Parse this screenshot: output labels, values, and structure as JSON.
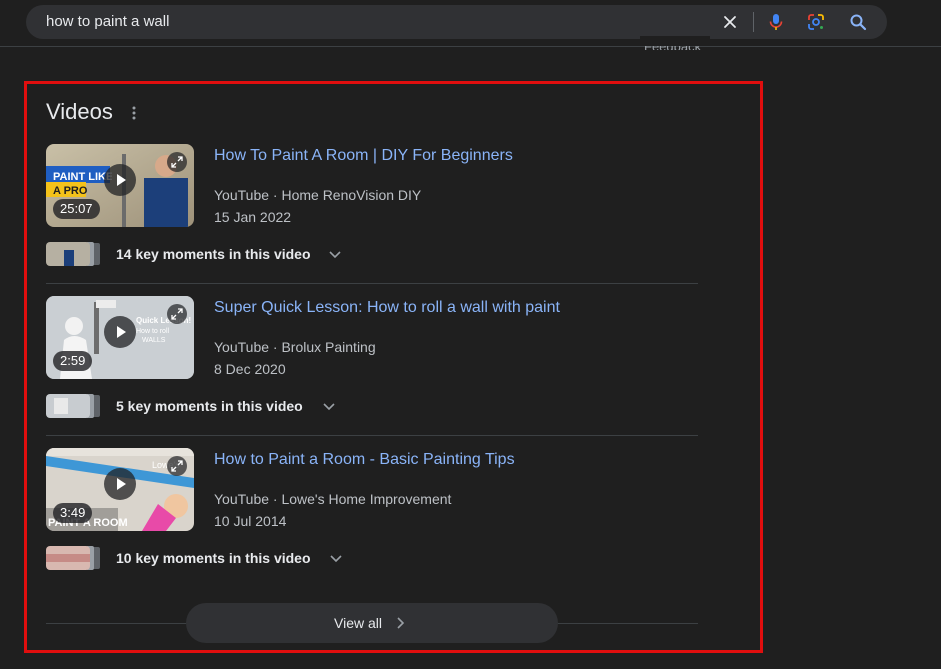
{
  "search": {
    "query": "how to paint a wall",
    "clear_icon": "close-icon",
    "mic_icon": "microphone-icon",
    "lens_icon": "google-lens-icon",
    "search_icon": "search-icon"
  },
  "feedback": {
    "label": "Feedback"
  },
  "videos": {
    "title": "Videos",
    "menu_icon": "more-vert-icon",
    "items": [
      {
        "title": "How To Paint A Room | DIY For Beginners",
        "source": "YouTube · Home RenoVision DIY",
        "date": "15 Jan 2022",
        "duration": "25:07",
        "moments": "14 key moments in this video",
        "thumb_text": [
          "PAINT LIKE",
          "A PRO"
        ]
      },
      {
        "title": "Super Quick Lesson: How to roll a wall with paint",
        "source": "YouTube · Brolux Painting",
        "date": "8 Dec 2020",
        "duration": "2:59",
        "moments": "5 key moments in this video",
        "thumb_text": [
          "Quick Lesson!",
          "How to roll",
          "WALLS"
        ]
      },
      {
        "title": "How to Paint a Room - Basic Painting Tips",
        "source": "YouTube · Lowe's Home Improvement",
        "date": "10 Jul 2014",
        "duration": "3:49",
        "moments": "10 key moments in this video",
        "thumb_text": [
          "PAINT A ROOM",
          "Lowe's"
        ]
      }
    ],
    "view_all": "View all"
  },
  "colors": {
    "background": "#1f1f1f",
    "link": "#8ab4f8",
    "highlight_border": "#e00e0e",
    "muted_text": "#bdc1c6"
  }
}
